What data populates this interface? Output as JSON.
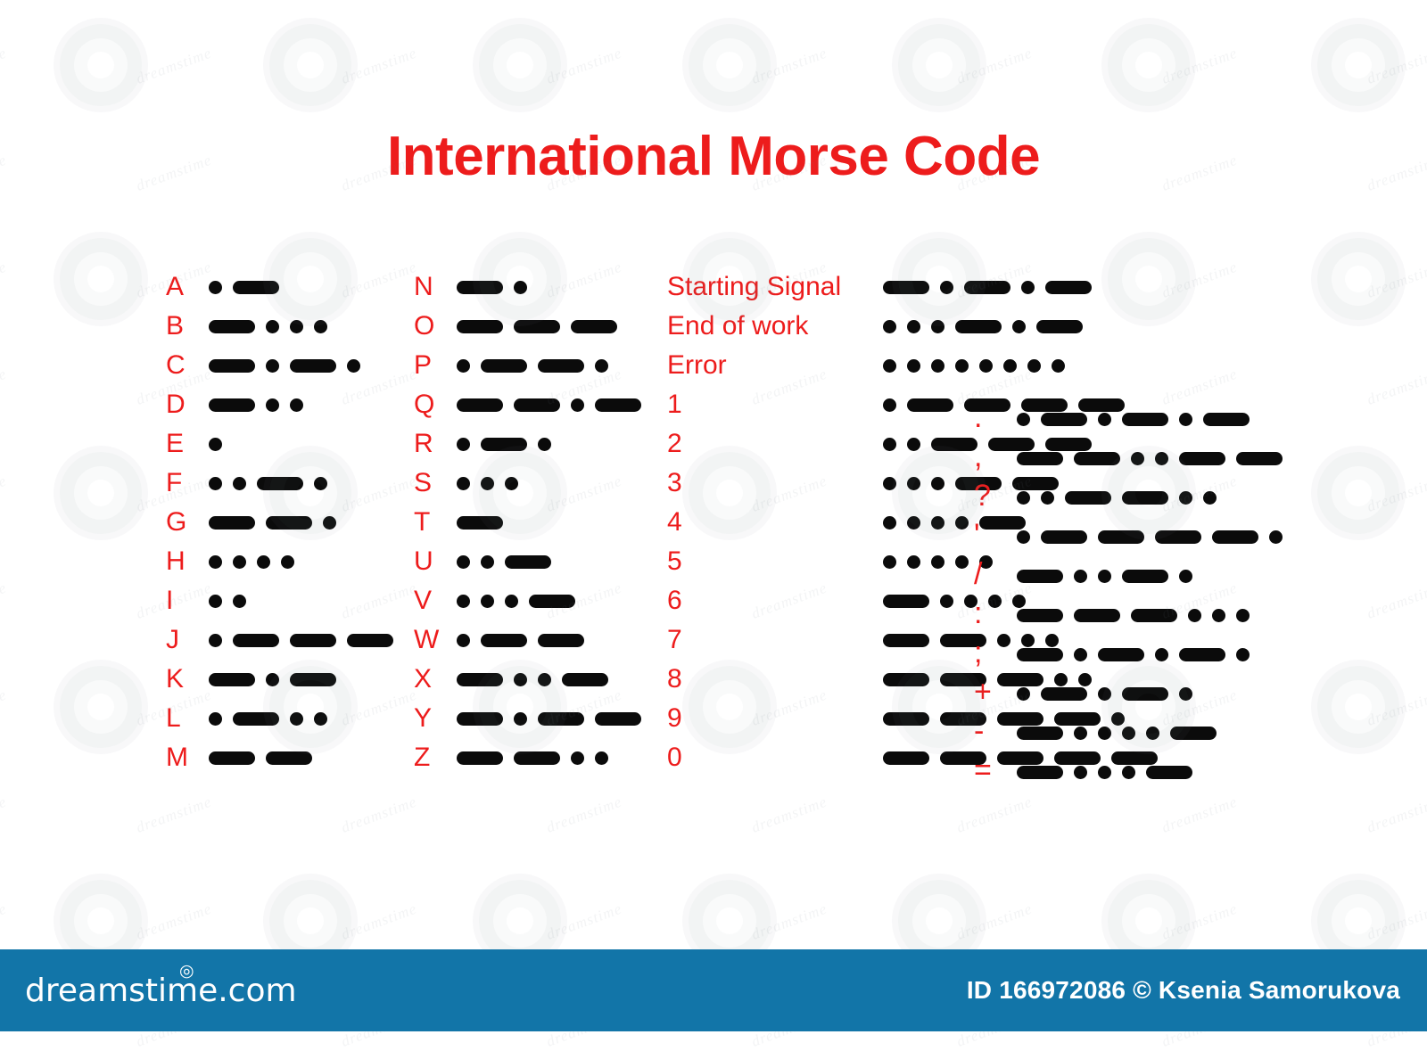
{
  "title": "International Morse Code",
  "colors": {
    "accent_red": "#ed1c1c",
    "code_black": "#0b0b0b",
    "footer_blue": "#1275a8",
    "background": "#ffffff"
  },
  "chart_data": {
    "type": "table",
    "title": "International Morse Code",
    "columns": [
      {
        "id": "letters-1",
        "rows": [
          {
            "label": "A",
            "code": ".-"
          },
          {
            "label": "B",
            "code": "-..."
          },
          {
            "label": "C",
            "code": "-.-."
          },
          {
            "label": "D",
            "code": "-.."
          },
          {
            "label": "E",
            "code": "."
          },
          {
            "label": "F",
            "code": "..-."
          },
          {
            "label": "G",
            "code": "--."
          },
          {
            "label": "H",
            "code": "...."
          },
          {
            "label": "I",
            "code": ".."
          },
          {
            "label": "J",
            "code": ".---"
          },
          {
            "label": "K",
            "code": "-.-"
          },
          {
            "label": "L",
            "code": ".-.."
          },
          {
            "label": "M",
            "code": "--"
          }
        ]
      },
      {
        "id": "letters-2",
        "rows": [
          {
            "label": "N",
            "code": "-."
          },
          {
            "label": "O",
            "code": "---"
          },
          {
            "label": "P",
            "code": ".--."
          },
          {
            "label": "Q",
            "code": "--.-"
          },
          {
            "label": "R",
            "code": ".-."
          },
          {
            "label": "S",
            "code": "..."
          },
          {
            "label": "T",
            "code": "-"
          },
          {
            "label": "U",
            "code": "..-"
          },
          {
            "label": "V",
            "code": "...-"
          },
          {
            "label": "W",
            "code": ".--"
          },
          {
            "label": "X",
            "code": "-..-"
          },
          {
            "label": "Y",
            "code": "-.--"
          },
          {
            "label": "Z",
            "code": "--.."
          }
        ]
      },
      {
        "id": "signals-and-numbers",
        "rows": [
          {
            "label": "Starting Signal",
            "code": "-.-.-"
          },
          {
            "label": "End of work",
            "code": "...-.-"
          },
          {
            "label": "Error",
            "code": "........"
          },
          {
            "label": "1",
            "code": ".----"
          },
          {
            "label": "2",
            "code": "..---"
          },
          {
            "label": "3",
            "code": "...--"
          },
          {
            "label": "4",
            "code": "....-"
          },
          {
            "label": "5",
            "code": "....."
          },
          {
            "label": "6",
            "code": "-...."
          },
          {
            "label": "7",
            "code": "--..."
          },
          {
            "label": "8",
            "code": "---.."
          },
          {
            "label": "9",
            "code": "----."
          },
          {
            "label": "0",
            "code": "-----"
          }
        ]
      },
      {
        "id": "punctuation",
        "rows": [
          {
            "label": ".",
            "code": ".-.-.-"
          },
          {
            "label": ",",
            "code": "--..--"
          },
          {
            "label": "?",
            "code": "..--.."
          },
          {
            "label": "'",
            "code": ".----."
          },
          {
            "label": "/",
            "code": "-..-."
          },
          {
            "label": ":",
            "code": "---..."
          },
          {
            "label": ";",
            "code": "-.-.-."
          },
          {
            "label": "+",
            "code": ".-.-."
          },
          {
            "label": "-",
            "code": "-....-"
          },
          {
            "label": "=",
            "code": "-...-"
          }
        ]
      }
    ]
  },
  "footer": {
    "logo_text": "dreamstime.com",
    "logo_mark": "◎",
    "credit": "ID 166972086 © Ksenia Samorukova"
  },
  "watermark": {
    "text": "dreamstime"
  }
}
